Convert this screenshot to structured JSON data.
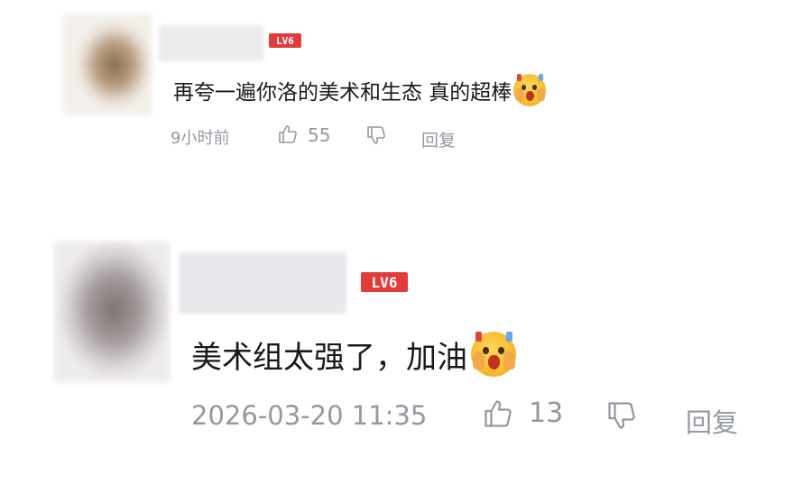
{
  "comments": [
    {
      "level_badge": "LV6",
      "content_text": "再夸一遍你洛的美术和生态 真的超棒",
      "emoji_icon": "crying-clapping-emoji",
      "time": "9小时前",
      "like_count": "55",
      "reply_label": "回复"
    },
    {
      "level_badge": "LV6",
      "content_text": "美术组太强了，加油",
      "emoji_icon": "crying-clapping-emoji",
      "time": "2026-03-20 11:35",
      "like_count": "13",
      "reply_label": "回复"
    }
  ],
  "colors": {
    "level_badge": "#e23b3b",
    "meta_text": "#9499a0",
    "body_text": "#18191c"
  }
}
